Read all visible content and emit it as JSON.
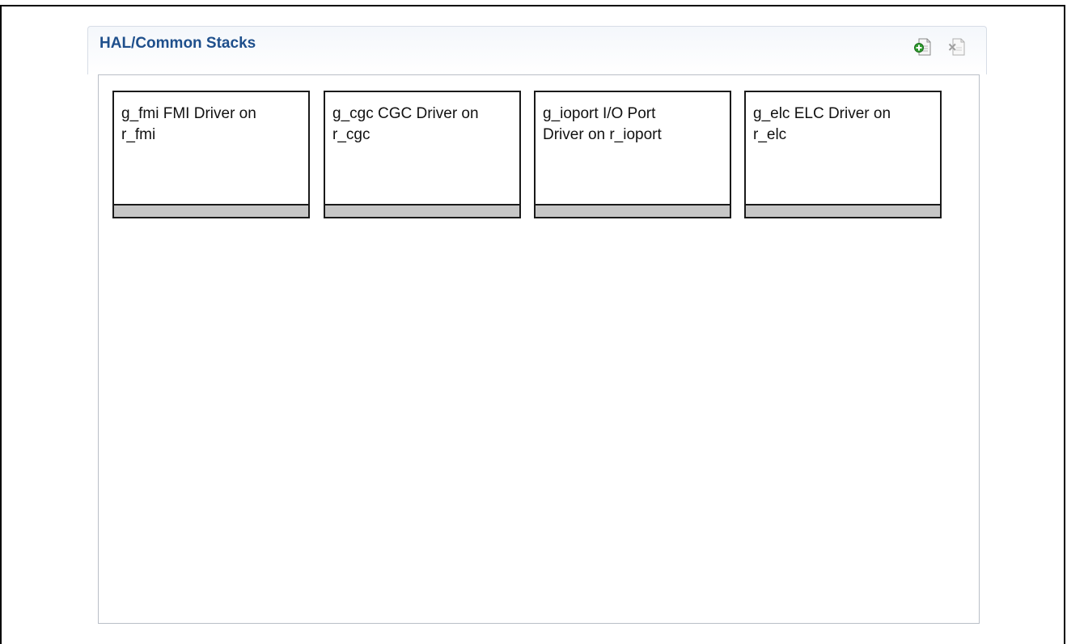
{
  "panel": {
    "title": "HAL/Common Stacks",
    "add_icon": "new-stack-icon",
    "remove_icon": "remove-stack-icon"
  },
  "stacks": [
    {
      "label": "g_fmi FMI Driver on\nr_fmi"
    },
    {
      "label": "g_cgc CGC Driver on\nr_cgc"
    },
    {
      "label": "g_ioport I/O Port\nDriver on r_ioport"
    },
    {
      "label": "g_elc ELC Driver on\nr_elc"
    }
  ]
}
